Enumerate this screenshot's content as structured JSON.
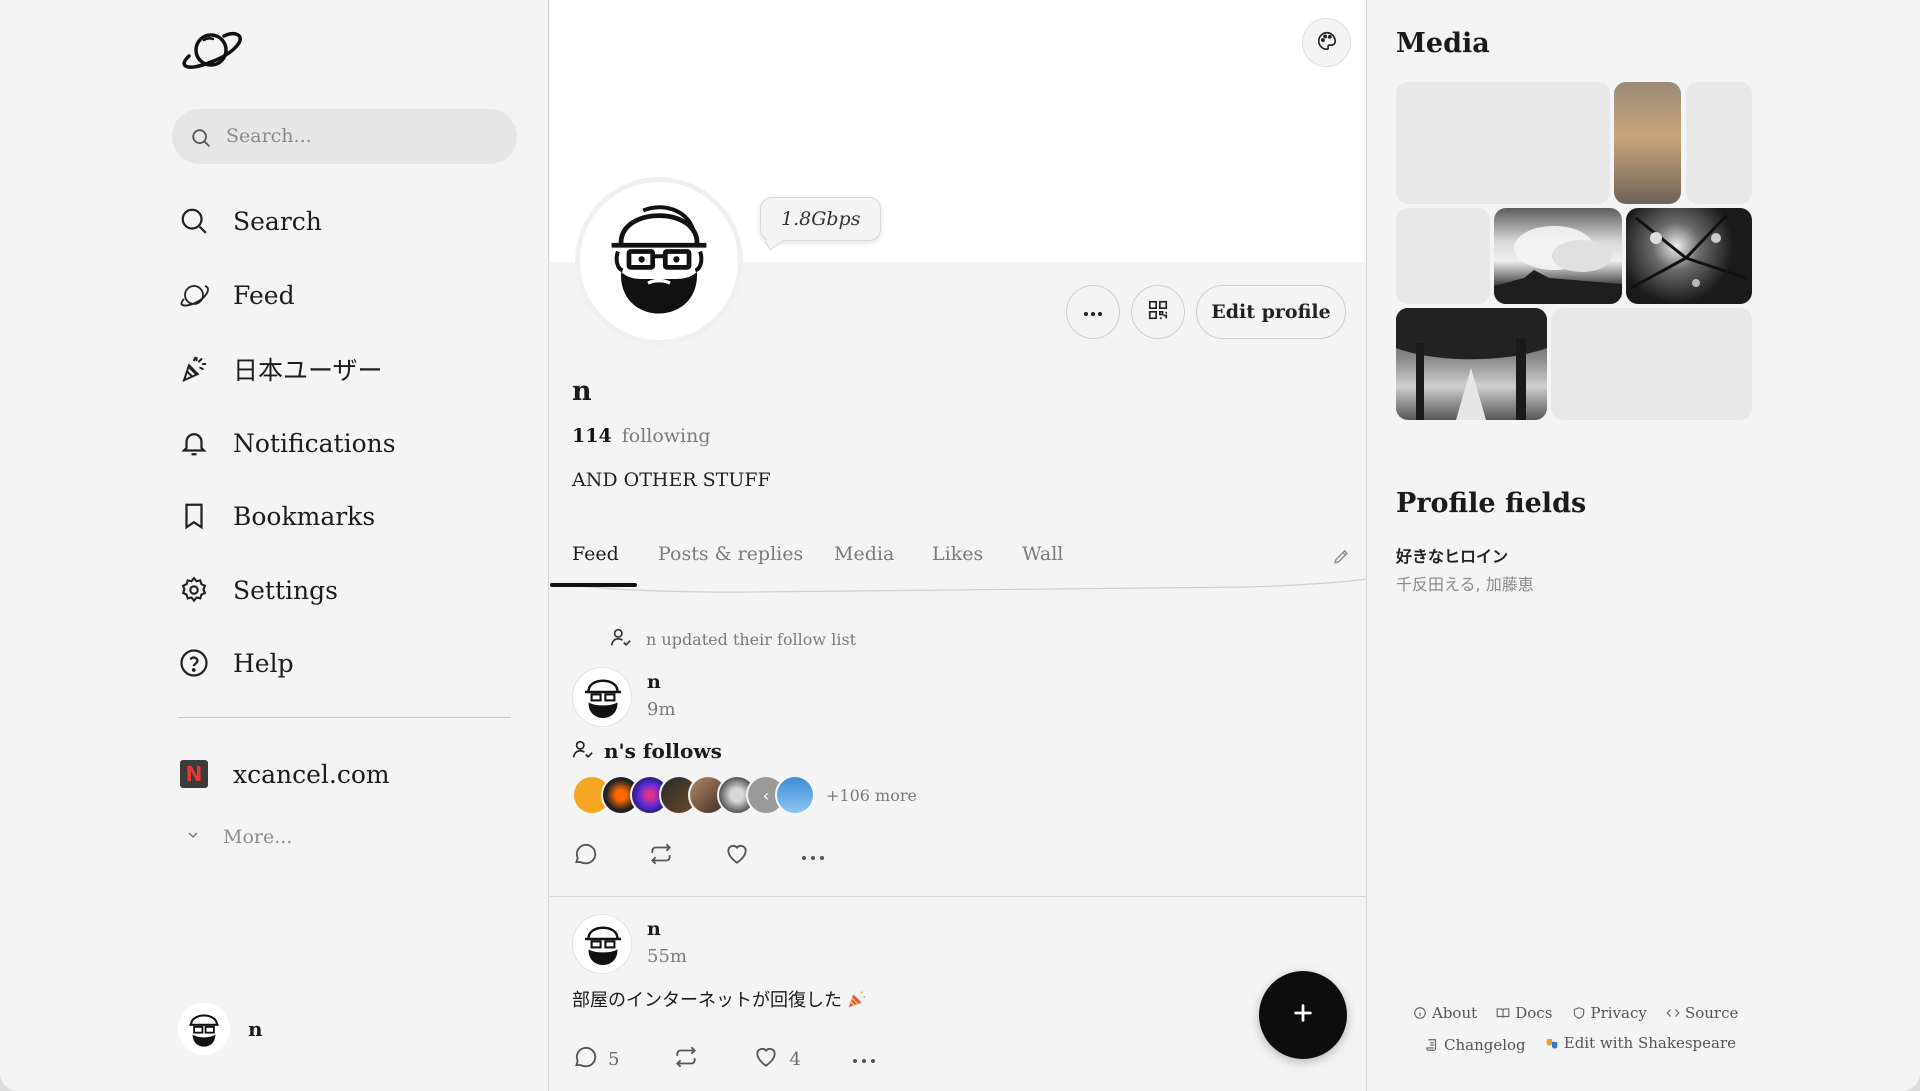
{
  "search": {
    "placeholder": "Search..."
  },
  "nav": {
    "items": [
      {
        "label": "Search",
        "icon": "search-icon"
      },
      {
        "label": "Feed",
        "icon": "planet-icon"
      },
      {
        "label": "日本ユーザー",
        "icon": "party-popper-icon"
      },
      {
        "label": "Notifications",
        "icon": "bell-icon"
      },
      {
        "label": "Bookmarks",
        "icon": "bookmark-icon"
      },
      {
        "label": "Settings",
        "icon": "gear-icon"
      },
      {
        "label": "Help",
        "icon": "help-circle-icon"
      }
    ],
    "extra": {
      "label": "xcancel.com",
      "icon_letter": "N"
    },
    "more": "More..."
  },
  "current_user": {
    "name": "n"
  },
  "profile": {
    "status": "1.8Gbps",
    "name": "n",
    "following_count": "114",
    "following_label": "following",
    "bio": "AND OTHER STUFF",
    "edit_label": "Edit profile"
  },
  "tabs": [
    "Feed",
    "Posts & replies",
    "Media",
    "Likes",
    "Wall"
  ],
  "feed": {
    "activity": "n updated their follow list",
    "post1": {
      "author": "n",
      "time": "9m",
      "follows_title": "n's follows",
      "more_count": "+106 more"
    },
    "post2": {
      "author": "n",
      "time": "55m",
      "text": "部屋のインターネットが回復した",
      "replies": "5",
      "likes": "4"
    }
  },
  "sidebar": {
    "media_title": "Media",
    "fields_title": "Profile fields",
    "field_name": "好きなヒロイン",
    "field_value": "千反田える, 加藤恵"
  },
  "footer": {
    "links": [
      "About",
      "Docs",
      "Privacy",
      "Source",
      "Changelog",
      "Edit with Shakespeare"
    ]
  },
  "colors": {
    "accent": "#0d0d0d",
    "background": "#f4f4f4",
    "muted": "#7b7b7b"
  }
}
